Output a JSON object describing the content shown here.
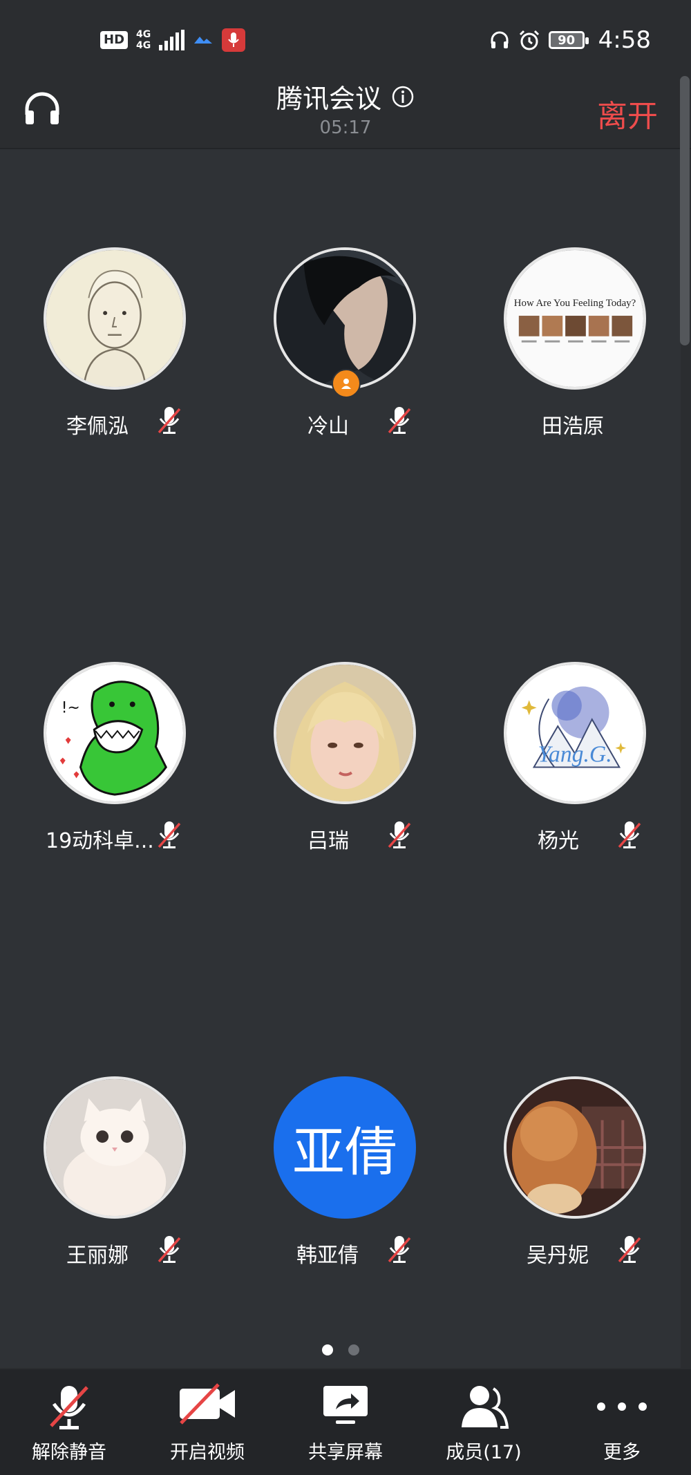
{
  "status_bar": {
    "hd": "HD",
    "network": "4G",
    "network_sub": "4G",
    "battery": "90",
    "time": "4:58"
  },
  "header": {
    "title": "腾讯会议",
    "timer": "05:17",
    "leave_label": "离开"
  },
  "participants": [
    {
      "name": "李佩泓",
      "muted": true,
      "avatar": "sketch-boy"
    },
    {
      "name": "冷山",
      "muted": true,
      "avatar": "man-portrait",
      "host": true
    },
    {
      "name": "田浩原",
      "muted": false,
      "avatar": "feeling-chart",
      "avatar_caption": "How Are You Feeling Today?"
    },
    {
      "name": "19动科卓...",
      "muted": true,
      "avatar": "green-dino"
    },
    {
      "name": "吕瑞",
      "muted": true,
      "avatar": "blonde-girl"
    },
    {
      "name": "杨光",
      "muted": true,
      "avatar": "watercolor-logo",
      "avatar_caption": "Yang.G."
    },
    {
      "name": "王丽娜",
      "muted": true,
      "avatar": "white-kitten"
    },
    {
      "name": "韩亚倩",
      "muted": true,
      "avatar": "text",
      "avatar_text": "亚倩"
    },
    {
      "name": "吴丹妮",
      "muted": true,
      "avatar": "dog-photo"
    }
  ],
  "pagination": {
    "pages": 2,
    "current": 1
  },
  "toolbar": {
    "unmute": "解除静音",
    "start_video": "开启视频",
    "share_screen": "共享屏幕",
    "members": "成员(17)",
    "more": "更多"
  },
  "colors": {
    "background": "#2f3236",
    "leave": "#ee4c4c",
    "mute_slash": "#e64545",
    "text_avatar": "#1a6fed",
    "host_badge": "#f48a1b"
  }
}
